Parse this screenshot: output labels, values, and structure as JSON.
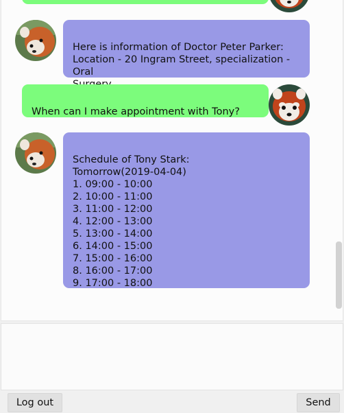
{
  "conversation": {
    "messages": [
      {
        "sender": "user",
        "text": ""
      },
      {
        "sender": "bot",
        "text": "Here is information of Doctor Peter Parker:\nLocation - 20 Ingram Street, specialization - Oral\nSurgery"
      },
      {
        "sender": "user",
        "text": "When can I make appointment with Tony?"
      },
      {
        "sender": "bot",
        "text": "Schedule of Tony Stark:\nTomorrow(2019-04-04)\n1. 09:00 - 10:00\n2. 10:00 - 11:00\n3. 11:00 - 12:00\n4. 12:00 - 13:00\n5. 13:00 - 14:00\n6. 14:00 - 15:00\n7. 15:00 - 16:00\n8. 16:00 - 17:00\n9. 17:00 - 18:00"
      }
    ]
  },
  "input": {
    "value": ""
  },
  "buttons": {
    "logout_label": "Log out",
    "send_label": "Send"
  },
  "colors": {
    "bot_bubble": "#9999e6",
    "user_bubble": "#7cfc7c"
  },
  "icons": {
    "bot_avatar": "red-panda-bot-avatar-icon",
    "user_avatar": "red-panda-user-avatar-icon"
  }
}
